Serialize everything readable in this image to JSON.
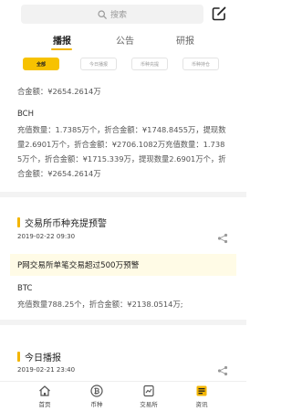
{
  "search": {
    "placeholder": "搜索",
    "icon": "search-icon"
  },
  "edit": {
    "icon": "edit-icon"
  },
  "tabs": [
    {
      "label": "播报",
      "active": true
    },
    {
      "label": "公告",
      "active": false
    },
    {
      "label": "研报",
      "active": false
    }
  ],
  "filters": [
    {
      "label": "全部",
      "active": true
    },
    {
      "label": "今日播报",
      "active": false
    },
    {
      "label": "币种充提",
      "active": false
    },
    {
      "label": "币种持仓",
      "active": false
    }
  ],
  "feed": {
    "block1": {
      "line_top": "合金额：¥2654.2614万",
      "coin": "BCH",
      "lines": [
        "充值数量：1.7385万个，折合金额：¥1748.8455万，提现数",
        "量2.6901万个，折合金额：¥2706.1082万充值数量：1.738",
        "5万个，折合金额：¥1715.339万，提现数量2.6901万个，折",
        "合金额：¥2654.2614万"
      ]
    },
    "block2": {
      "title": "交易所币种充提预警",
      "date": "2019-02-22 09:30",
      "alert": "P网交易所单笔交易超过500万预警",
      "coin": "BTC",
      "line": "充值数量788.25个，折合金额：¥2138.0514万;"
    },
    "block3": {
      "title": "今日播报",
      "date": "2019-02-21 23:40"
    }
  },
  "bottom_nav": [
    {
      "label": "首页",
      "icon": "home-icon",
      "active": false
    },
    {
      "label": "币种",
      "icon": "bitcoin-icon",
      "active": false
    },
    {
      "label": "交易所",
      "icon": "exchange-icon",
      "active": false
    },
    {
      "label": "资讯",
      "icon": "news-icon",
      "active": true
    }
  ],
  "colors": {
    "accent": "#f3b500",
    "chip_active": "#f7c200",
    "alert_bg": "#fffbe6"
  }
}
